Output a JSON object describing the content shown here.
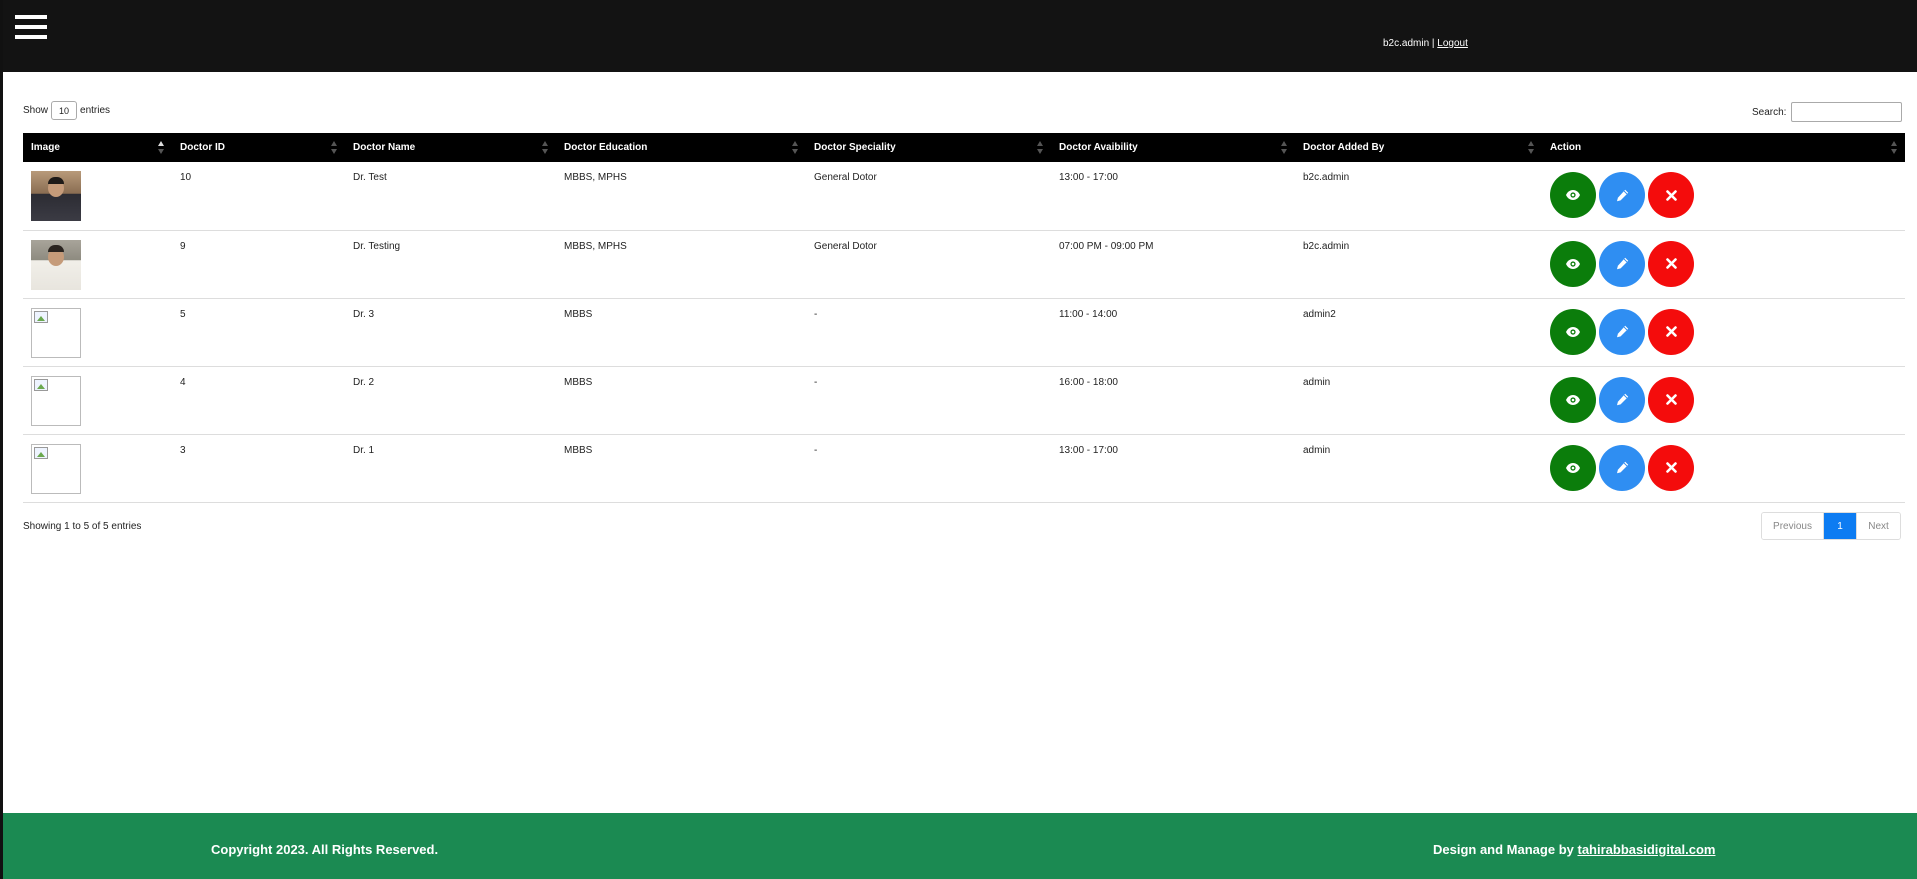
{
  "header": {
    "username": "b2c.admin",
    "separator": " | ",
    "logout_label": "Logout"
  },
  "table_controls": {
    "show_label": "Show",
    "page_length": "10",
    "entries_label": "entries",
    "search_label": "Search:",
    "search_value": ""
  },
  "table": {
    "columns": [
      "Image",
      "Doctor ID",
      "Doctor Name",
      "Doctor Education",
      "Doctor Speciality",
      "Doctor Avaibility",
      "Doctor Added By",
      "Action"
    ],
    "rows": [
      {
        "image": "photo",
        "id": "10",
        "name": "Dr. Test",
        "education": "MBBS, MPHS",
        "speciality": "General Dotor",
        "availability": "13:00 - 17:00",
        "added_by": "b2c.admin"
      },
      {
        "image": "photo",
        "id": "9",
        "name": "Dr. Testing",
        "education": "MBBS, MPHS",
        "speciality": "General Dotor",
        "availability": "07:00 PM - 09:00 PM",
        "added_by": "b2c.admin"
      },
      {
        "image": "broken",
        "id": "5",
        "name": "Dr. 3",
        "education": "MBBS",
        "speciality": "-",
        "availability": "11:00 - 14:00",
        "added_by": "admin2"
      },
      {
        "image": "broken",
        "id": "4",
        "name": "Dr. 2",
        "education": "MBBS",
        "speciality": "-",
        "availability": "16:00 - 18:00",
        "added_by": "admin"
      },
      {
        "image": "broken",
        "id": "3",
        "name": "Dr. 1",
        "education": "MBBS",
        "speciality": "-",
        "availability": "13:00 - 17:00",
        "added_by": "admin"
      }
    ],
    "action_icons": [
      "eye-icon",
      "pencil-icon",
      "close-icon"
    ]
  },
  "footer_info": {
    "showing": "Showing 1 to 5 of 5 entries"
  },
  "pagination": {
    "previous": "Previous",
    "current": "1",
    "next": "Next"
  },
  "footer": {
    "copyright": "Copyright 2023. All Rights Reserved.",
    "credit_prefix": "Design and Manage by ",
    "credit_link": "tahirabbasidigital.com"
  },
  "colors": {
    "topbar": "#131313",
    "view_button": "#0b7d0b",
    "edit_button": "#2f8ef2",
    "delete_button": "#f40c0c",
    "footer": "#1b8a52",
    "pager_active": "#0d7cf2"
  }
}
